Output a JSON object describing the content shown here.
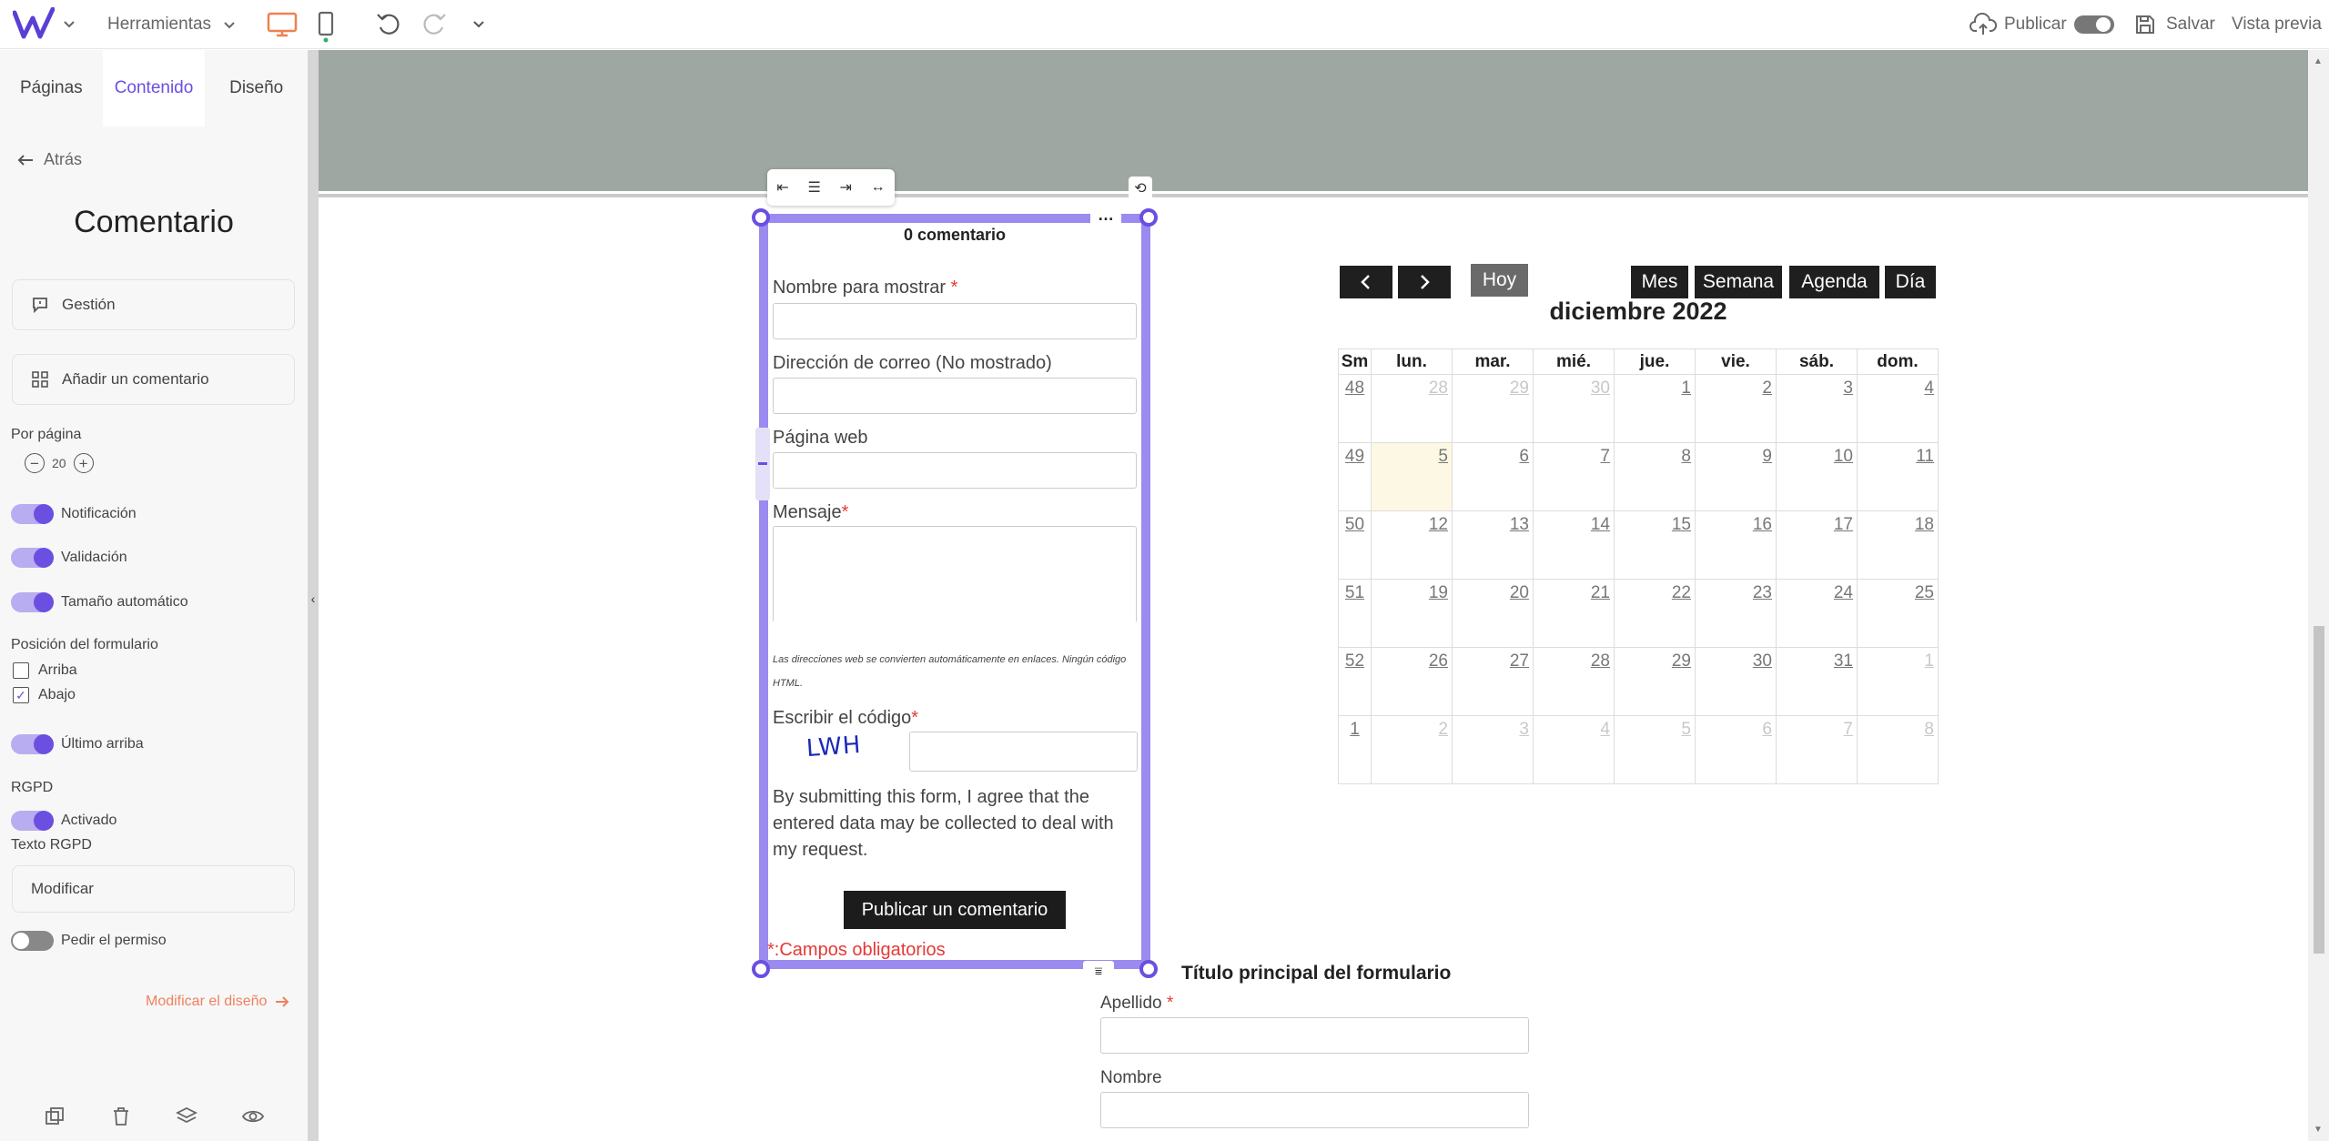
{
  "topbar": {
    "tools_label": "Herramientas",
    "publish_label": "Publicar",
    "save_label": "Salvar",
    "preview_label": "Vista previa",
    "accent": "#6b4fe0",
    "device_accent": "#f08050"
  },
  "sidebar": {
    "tabs": [
      "Páginas",
      "Contenido",
      "Diseño"
    ],
    "back_label": "Atrás",
    "title": "Comentario",
    "manage_label": "Gestión",
    "add_comment_label": "Añadir un comentario",
    "per_page_label": "Por página",
    "per_page_value": "20",
    "toggles": [
      {
        "label": "Notificación",
        "on": true
      },
      {
        "label": "Validación",
        "on": true
      },
      {
        "label": "Tamaño automático",
        "on": true
      }
    ],
    "form_position_label": "Posición del formulario",
    "form_position_options": [
      {
        "label": "Arriba",
        "checked": false
      },
      {
        "label": "Abajo",
        "checked": true
      }
    ],
    "last_on_top_label": "Último arriba",
    "gdpr_heading": "RGPD",
    "gdpr_enabled_label": "Activado",
    "gdpr_text_label": "Texto RGPD",
    "modify_label": "Modificar",
    "ask_permission_label": "Pedir el permiso",
    "modify_design_label": "Modificar el diseño"
  },
  "comment_form": {
    "heading": "0 comentario",
    "display_name_label": "Nombre para mostrar",
    "email_label": "Dirección de correo (No mostrado)",
    "website_label": "Página web",
    "message_label": "Mensaje",
    "note": "Las direcciones web se convierten automáticamente en enlaces. Ningún código HTML.",
    "code_label": "Escribir el código",
    "captcha_text": "LWH",
    "consent_text": "By submitting this form, I agree that the entered data may be collected to deal with my request.",
    "submit_label": "Publicar un comentario",
    "required_note": "*:Campos obligatorios",
    "required_star": "*"
  },
  "second_form": {
    "title": "Título principal del formulario",
    "surname_label": "Apellido",
    "name_label": "Nombre"
  },
  "calendar": {
    "prev_label": "‹",
    "next_label": "›",
    "today_label": "Hoy",
    "views": [
      "Mes",
      "Semana",
      "Agenda",
      "Día"
    ],
    "title": "diciembre 2022",
    "headers": [
      "Sm",
      "lun.",
      "mar.",
      "mié.",
      "jue.",
      "vie.",
      "sáb.",
      "dom."
    ],
    "weeks": [
      {
        "wk": "48",
        "days": [
          "28",
          "29",
          "30",
          "1",
          "2",
          "3",
          "4"
        ],
        "other": [
          true,
          true,
          true,
          false,
          false,
          false,
          false
        ]
      },
      {
        "wk": "49",
        "days": [
          "5",
          "6",
          "7",
          "8",
          "9",
          "10",
          "11"
        ],
        "other": [
          false,
          false,
          false,
          false,
          false,
          false,
          false
        ],
        "today_index": 0
      },
      {
        "wk": "50",
        "days": [
          "12",
          "13",
          "14",
          "15",
          "16",
          "17",
          "18"
        ],
        "other": [
          false,
          false,
          false,
          false,
          false,
          false,
          false
        ]
      },
      {
        "wk": "51",
        "days": [
          "19",
          "20",
          "21",
          "22",
          "23",
          "24",
          "25"
        ],
        "other": [
          false,
          false,
          false,
          false,
          false,
          false,
          false
        ]
      },
      {
        "wk": "52",
        "days": [
          "26",
          "27",
          "28",
          "29",
          "30",
          "31",
          "1"
        ],
        "other": [
          false,
          false,
          false,
          false,
          false,
          false,
          true
        ]
      },
      {
        "wk": "1",
        "days": [
          "2",
          "3",
          "4",
          "5",
          "6",
          "7",
          "8"
        ],
        "other": [
          true,
          true,
          true,
          true,
          true,
          true,
          true
        ]
      }
    ]
  }
}
